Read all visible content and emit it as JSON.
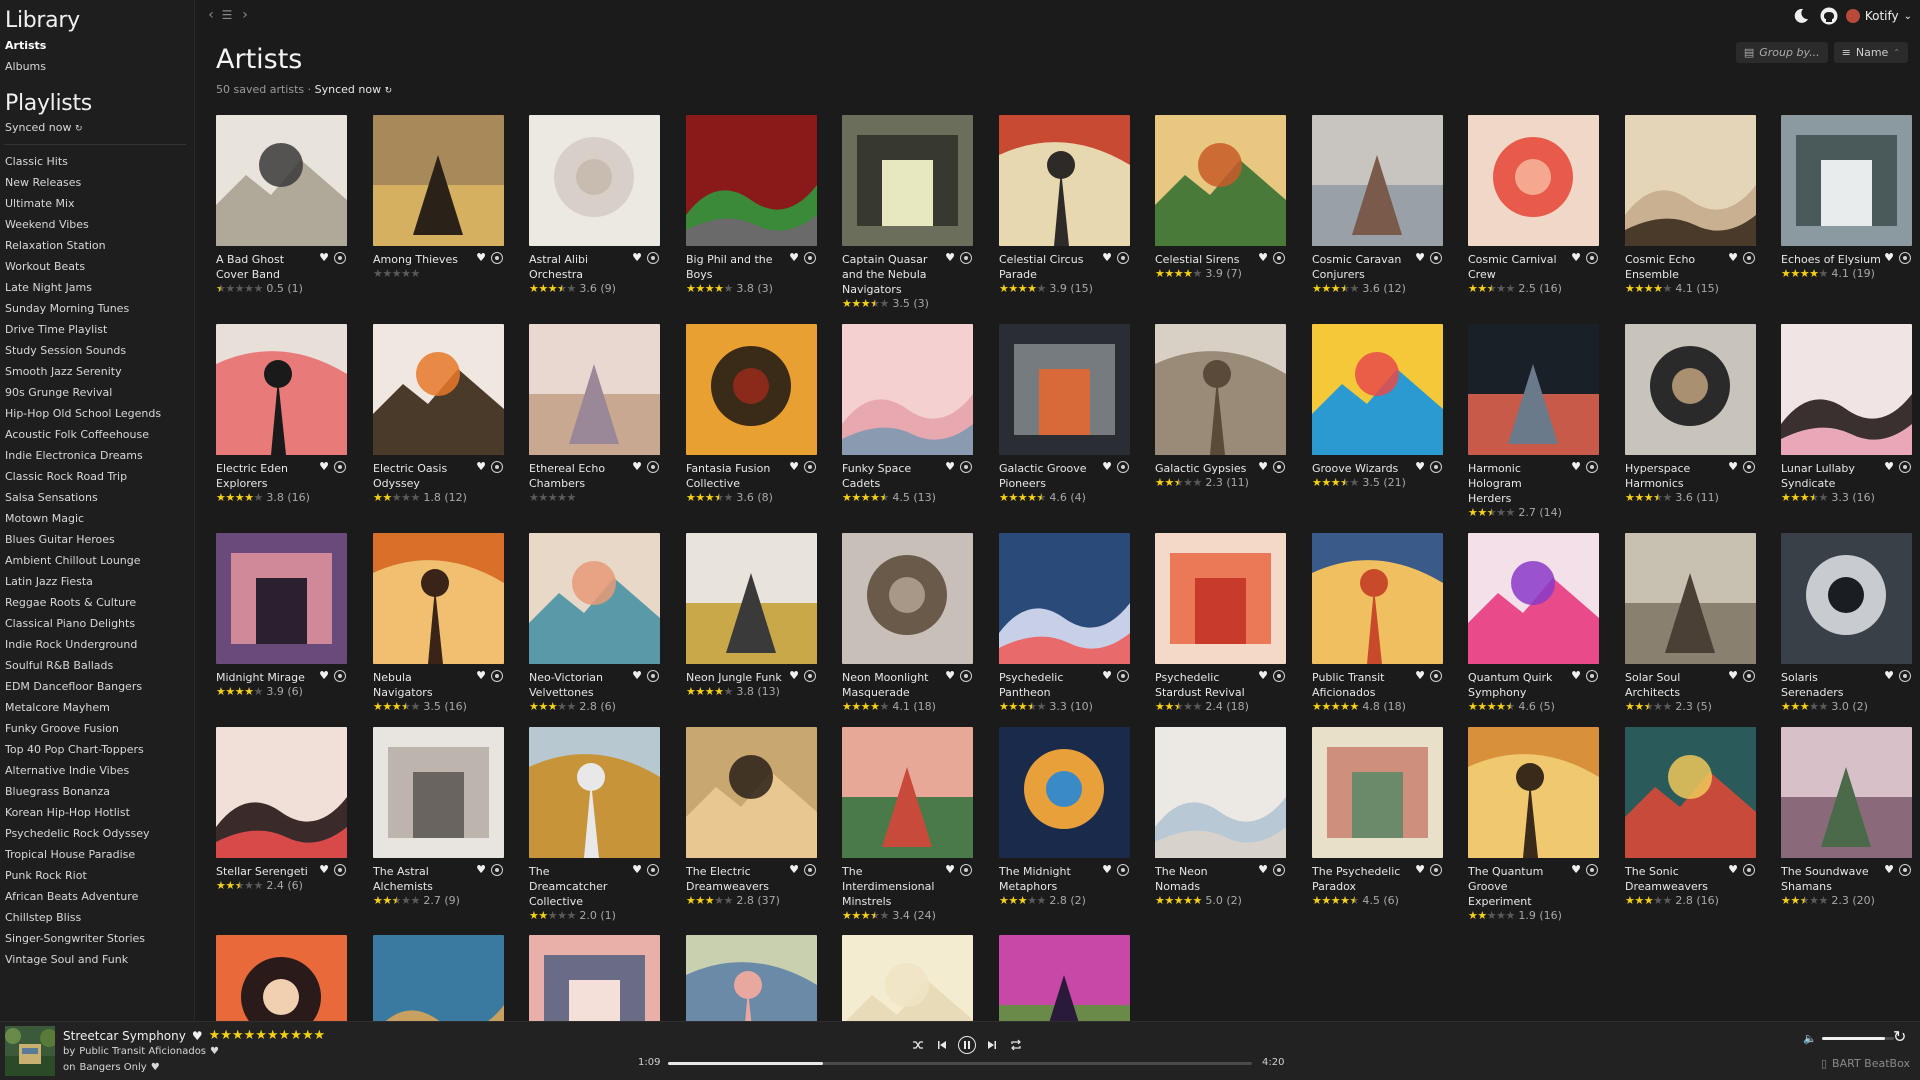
{
  "sidebar": {
    "library_heading": "Library",
    "library_items": [
      {
        "label": "Artists",
        "active": true
      },
      {
        "label": "Albums",
        "active": false
      }
    ],
    "playlists_heading": "Playlists",
    "synced_label": "Synced now",
    "playlists": [
      "Classic Hits",
      "New Releases",
      "Ultimate Mix",
      "Weekend Vibes",
      "Relaxation Station",
      "Workout Beats",
      "Late Night Jams",
      "Sunday Morning Tunes",
      "Drive Time Playlist",
      "Study Session Sounds",
      "Smooth Jazz Serenity",
      "90s Grunge Revival",
      "Hip-Hop Old School Legends",
      "Acoustic Folk Coffeehouse",
      "Indie Electronica Dreams",
      "Classic Rock Road Trip",
      "Salsa Sensations",
      "Motown Magic",
      "Blues Guitar Heroes",
      "Ambient Chillout Lounge",
      "Latin Jazz Fiesta",
      "Reggae Roots & Culture",
      "Classical Piano Delights",
      "Indie Rock Underground",
      "Soulful R&B Ballads",
      "EDM Dancefloor Bangers",
      "Metalcore Mayhem",
      "Funky Groove Fusion",
      "Top 40 Pop Chart-Toppers",
      "Alternative Indie Vibes",
      "Bluegrass Bonanza",
      "Korean Hip-Hop Hotlist",
      "Psychedelic Rock Odyssey",
      "Tropical House Paradise",
      "Punk Rock Riot",
      "African Beats Adventure",
      "Chillstep Bliss",
      "Singer-Songwriter Stories",
      "Vintage Soul and Funk"
    ]
  },
  "header": {
    "title": "Artists",
    "count_text": "50 saved artists",
    "separator": " · ",
    "synced_label": "Synced now",
    "group_by_label": "Group by...",
    "sort_label": "Name",
    "user_name": "Kotify"
  },
  "artists": [
    {
      "name": "A Bad Ghost Cover Band",
      "rating": 0.5,
      "count": 1,
      "c1": "#e8e4dc",
      "c2": "#3a3a3a",
      "c3": "#b0a898"
    },
    {
      "name": "Among Thieves",
      "rating": 0,
      "count": null,
      "c1": "#a8895a",
      "c2": "#2a2118",
      "c3": "#d4b060"
    },
    {
      "name": "Astral Alibi Orchestra",
      "rating": 3.6,
      "count": 9,
      "c1": "#ece8e2",
      "c2": "#d8d0c8",
      "c3": "#c8bcb0"
    },
    {
      "name": "Big Phil and the Boys",
      "rating": 3.8,
      "count": 3,
      "c1": "#8a1a1a",
      "c2": "#6a6a6a",
      "c3": "#3a8a3a"
    },
    {
      "name": "Captain Quasar and the Nebula Navigators",
      "rating": 3.5,
      "count": 3,
      "c1": "#6a6e5a",
      "c2": "#2a2c24",
      "c3": "#e8e8c0"
    },
    {
      "name": "Celestial Circus Parade",
      "rating": 3.9,
      "count": 15,
      "c1": "#c84a32",
      "c2": "#2e2a28",
      "c3": "#e8d8b0"
    },
    {
      "name": "Celestial Sirens",
      "rating": 3.9,
      "count": 7,
      "c1": "#e8c880",
      "c2": "#c85a28",
      "c3": "#4a7a3a"
    },
    {
      "name": "Cosmic Caravan Conjurers",
      "rating": 3.6,
      "count": 12,
      "c1": "#c8c4c0",
      "c2": "#7a5a4a",
      "c3": "#9aa0a8"
    },
    {
      "name": "Cosmic Carnival Crew",
      "rating": 2.5,
      "count": 16,
      "c1": "#f0d8c8",
      "c2": "#e85a4a",
      "c3": "#f4a890"
    },
    {
      "name": "Cosmic Echo Ensemble",
      "rating": 4.1,
      "count": 15,
      "c1": "#e4d4b8",
      "c2": "#4a3a2a",
      "c3": "#c8b090"
    },
    {
      "name": "Echoes of Elysium",
      "rating": 4.1,
      "count": 19,
      "c1": "#8a9aa0",
      "c2": "#3a4a4a",
      "c3": "#e8ecec"
    },
    {
      "name": "Electric Eden Explorers",
      "rating": 3.8,
      "count": 16,
      "c1": "#e8e0d8",
      "c2": "#1a1a1a",
      "c3": "#e87a7a"
    },
    {
      "name": "Electric Oasis Odyssey",
      "rating": 1.8,
      "count": 12,
      "c1": "#f0e8e0",
      "c2": "#e8782a",
      "c3": "#4a3a2a"
    },
    {
      "name": "Ethereal Echo Chambers",
      "rating": 0,
      "count": null,
      "c1": "#e8d8d0",
      "c2": "#9a8898",
      "c3": "#c8a890"
    },
    {
      "name": "Fantasia Fusion Collective",
      "rating": 3.6,
      "count": 8,
      "c1": "#e8a030",
      "c2": "#3a2a18",
      "c3": "#8a2a1a"
    },
    {
      "name": "Funky Space Cadets",
      "rating": 4.5,
      "count": 13,
      "c1": "#f4d0d0",
      "c2": "#8a9ab0",
      "c3": "#e8a8b0"
    },
    {
      "name": "Galactic Groove Pioneers",
      "rating": 4.6,
      "count": 4,
      "c1": "#2a2e34",
      "c2": "#8a8e94",
      "c3": "#d86a3a"
    },
    {
      "name": "Galactic Gypsies",
      "rating": 2.3,
      "count": 11,
      "c1": "#d8d0c4",
      "c2": "#5a4a3a",
      "c3": "#9a8a78"
    },
    {
      "name": "Groove Wizards",
      "rating": 3.5,
      "count": 21,
      "c1": "#f4c838",
      "c2": "#e84a4a",
      "c3": "#2a9ad0"
    },
    {
      "name": "Harmonic Hologram Herders",
      "rating": 2.7,
      "count": 14,
      "c1": "#1a2028",
      "c2": "#6a7a8a",
      "c3": "#c85a4a"
    },
    {
      "name": "Hyperspace Harmonics",
      "rating": 3.6,
      "count": 11,
      "c1": "#c8c4bc",
      "c2": "#2a2a2a",
      "c3": "#a89070"
    },
    {
      "name": "Lunar Lullaby Syndicate",
      "rating": 3.3,
      "count": 16,
      "c1": "#f0e4e4",
      "c2": "#e8a8b8",
      "c3": "#3a3030"
    },
    {
      "name": "Midnight Mirage",
      "rating": 3.9,
      "count": 6,
      "c1": "#6a4a7a",
      "c2": "#e898a0",
      "c3": "#2a2030"
    },
    {
      "name": "Nebula Navigators",
      "rating": 3.5,
      "count": 16,
      "c1": "#d8702a",
      "c2": "#3a2418",
      "c3": "#f0c070"
    },
    {
      "name": "Neo-Victorian Velvettones",
      "rating": 2.8,
      "count": 6,
      "c1": "#e8d8c8",
      "c2": "#e89a78",
      "c3": "#5a9aa8"
    },
    {
      "name": "Neon Jungle Funk",
      "rating": 3.8,
      "count": 13,
      "c1": "#e8e4dc",
      "c2": "#3a3a3a",
      "c3": "#c8a848"
    },
    {
      "name": "Neon Moonlight Masquerade",
      "rating": 4.1,
      "count": 18,
      "c1": "#c8c0b8",
      "c2": "#6a5a4a",
      "c3": "#a89888"
    },
    {
      "name": "Psychedelic Pantheon",
      "rating": 3.3,
      "count": 10,
      "c1": "#2a4a7a",
      "c2": "#e86a6a",
      "c3": "#c8d0e8"
    },
    {
      "name": "Psychedelic Stardust Revival",
      "rating": 2.4,
      "count": 18,
      "c1": "#f4d8c8",
      "c2": "#e8603a",
      "c3": "#c83a2a"
    },
    {
      "name": "Public Transit Aficionados",
      "rating": 4.8,
      "count": 18,
      "c1": "#3a5a8a",
      "c2": "#c84a2a",
      "c3": "#f0c060"
    },
    {
      "name": "Quantum Quirk Symphony",
      "rating": 4.6,
      "count": 5,
      "c1": "#f4e0e8",
      "c2": "#8a3ac8",
      "c3": "#e84a8a"
    },
    {
      "name": "Solar Soul Architects",
      "rating": 2.3,
      "count": 5,
      "c1": "#c8c0b0",
      "c2": "#4a4036",
      "c3": "#8a8070"
    },
    {
      "name": "Solaris Serenaders",
      "rating": 3.0,
      "count": 2,
      "c1": "#3a4048",
      "c2": "#c8ccd0",
      "c3": "#1a1e22"
    },
    {
      "name": "Stellar Serengeti",
      "rating": 2.4,
      "count": 6,
      "c1": "#f0e0d8",
      "c2": "#d84a4a",
      "c3": "#3a2a2a"
    },
    {
      "name": "The Astral Alchemists",
      "rating": 2.7,
      "count": 9,
      "c1": "#e8e4e0",
      "c2": "#b0a8a0",
      "c3": "#6a6460"
    },
    {
      "name": "The Dreamcatcher Collective",
      "rating": 2.0,
      "count": 1,
      "c1": "#b8c8d0",
      "c2": "#e8e8e8",
      "c3": "#c8943a"
    },
    {
      "name": "The Electric Dreamweavers",
      "rating": 2.8,
      "count": 37,
      "c1": "#c8a870",
      "c2": "#2a2018",
      "c3": "#e8c890"
    },
    {
      "name": "The Interdimensional Minstrels",
      "rating": 3.4,
      "count": 24,
      "c1": "#e8a898",
      "c2": "#c84a3a",
      "c3": "#4a7a4a"
    },
    {
      "name": "The Midnight Metaphors",
      "rating": 2.8,
      "count": 2,
      "c1": "#1a2a4a",
      "c2": "#e8a03a",
      "c3": "#3a8ac8"
    },
    {
      "name": "The Neon Nomads",
      "rating": 5.0,
      "count": 2,
      "c1": "#ece8e4",
      "c2": "#d8d2cc",
      "c3": "#b8c8d4"
    },
    {
      "name": "The Psychedelic Paradox",
      "rating": 4.5,
      "count": 6,
      "c1": "#e8e0c8",
      "c2": "#c87a6a",
      "c3": "#6a8a6a"
    },
    {
      "name": "The Quantum Groove Experiment",
      "rating": 1.9,
      "count": 16,
      "c1": "#d8903a",
      "c2": "#3a2a1a",
      "c3": "#f0c870"
    },
    {
      "name": "The Sonic Dreamweavers",
      "rating": 2.8,
      "count": 16,
      "c1": "#2a5a5a",
      "c2": "#f0c85a",
      "c3": "#c84a3a"
    },
    {
      "name": "The Soundwave Shamans",
      "rating": 2.3,
      "count": 20,
      "c1": "#d8c0c8",
      "c2": "#4a6a4a",
      "c3": "#8a6a7a"
    },
    {
      "name": "",
      "rating": null,
      "count": null,
      "c1": "#e86a3a",
      "c2": "#2a1a1a",
      "c3": "#f0d0b0"
    },
    {
      "name": "",
      "rating": null,
      "count": null,
      "c1": "#3a7aa0",
      "c2": "#f0e8d0",
      "c3": "#c8a060"
    },
    {
      "name": "",
      "rating": null,
      "count": null,
      "c1": "#e8b0a8",
      "c2": "#4a5a7a",
      "c3": "#f4e0d8"
    },
    {
      "name": "",
      "rating": null,
      "count": null,
      "c1": "#c8d0b0",
      "c2": "#e8a8a0",
      "c3": "#6a8aa8"
    },
    {
      "name": "",
      "rating": null,
      "count": null,
      "c1": "#f4ecd0",
      "c2": "#efe4c4",
      "c3": "#e8dcb8"
    },
    {
      "name": "",
      "rating": null,
      "count": null,
      "c1": "#c848a8",
      "c2": "#2a1a3a",
      "c3": "#6a8a4a"
    }
  ],
  "player": {
    "track_title": "Streetcar Symphony",
    "track_rating": 10,
    "artist_prefix": "by ",
    "artist_name": "Public Transit Aficionados",
    "album_prefix": "on ",
    "album_name": "Bangers Only",
    "time_current": "1:09",
    "time_total": "4:20",
    "progress_fraction": 0.265,
    "volume_fraction": 0.88,
    "device_name": "BART BeatBox"
  },
  "colors": {
    "accent_star": "#f4d017",
    "background": "#1b1b1b",
    "sidebar_bg": "#1e1e1e"
  },
  "icons": [
    "back-icon",
    "forward-icon",
    "queue-icon",
    "moon-icon",
    "github-icon",
    "chevron-down-icon",
    "heart-icon",
    "more-icon",
    "shuffle-icon",
    "previous-icon",
    "pause-icon",
    "next-icon",
    "repeat-icon",
    "volume-icon",
    "refresh-icon",
    "device-icon"
  ]
}
